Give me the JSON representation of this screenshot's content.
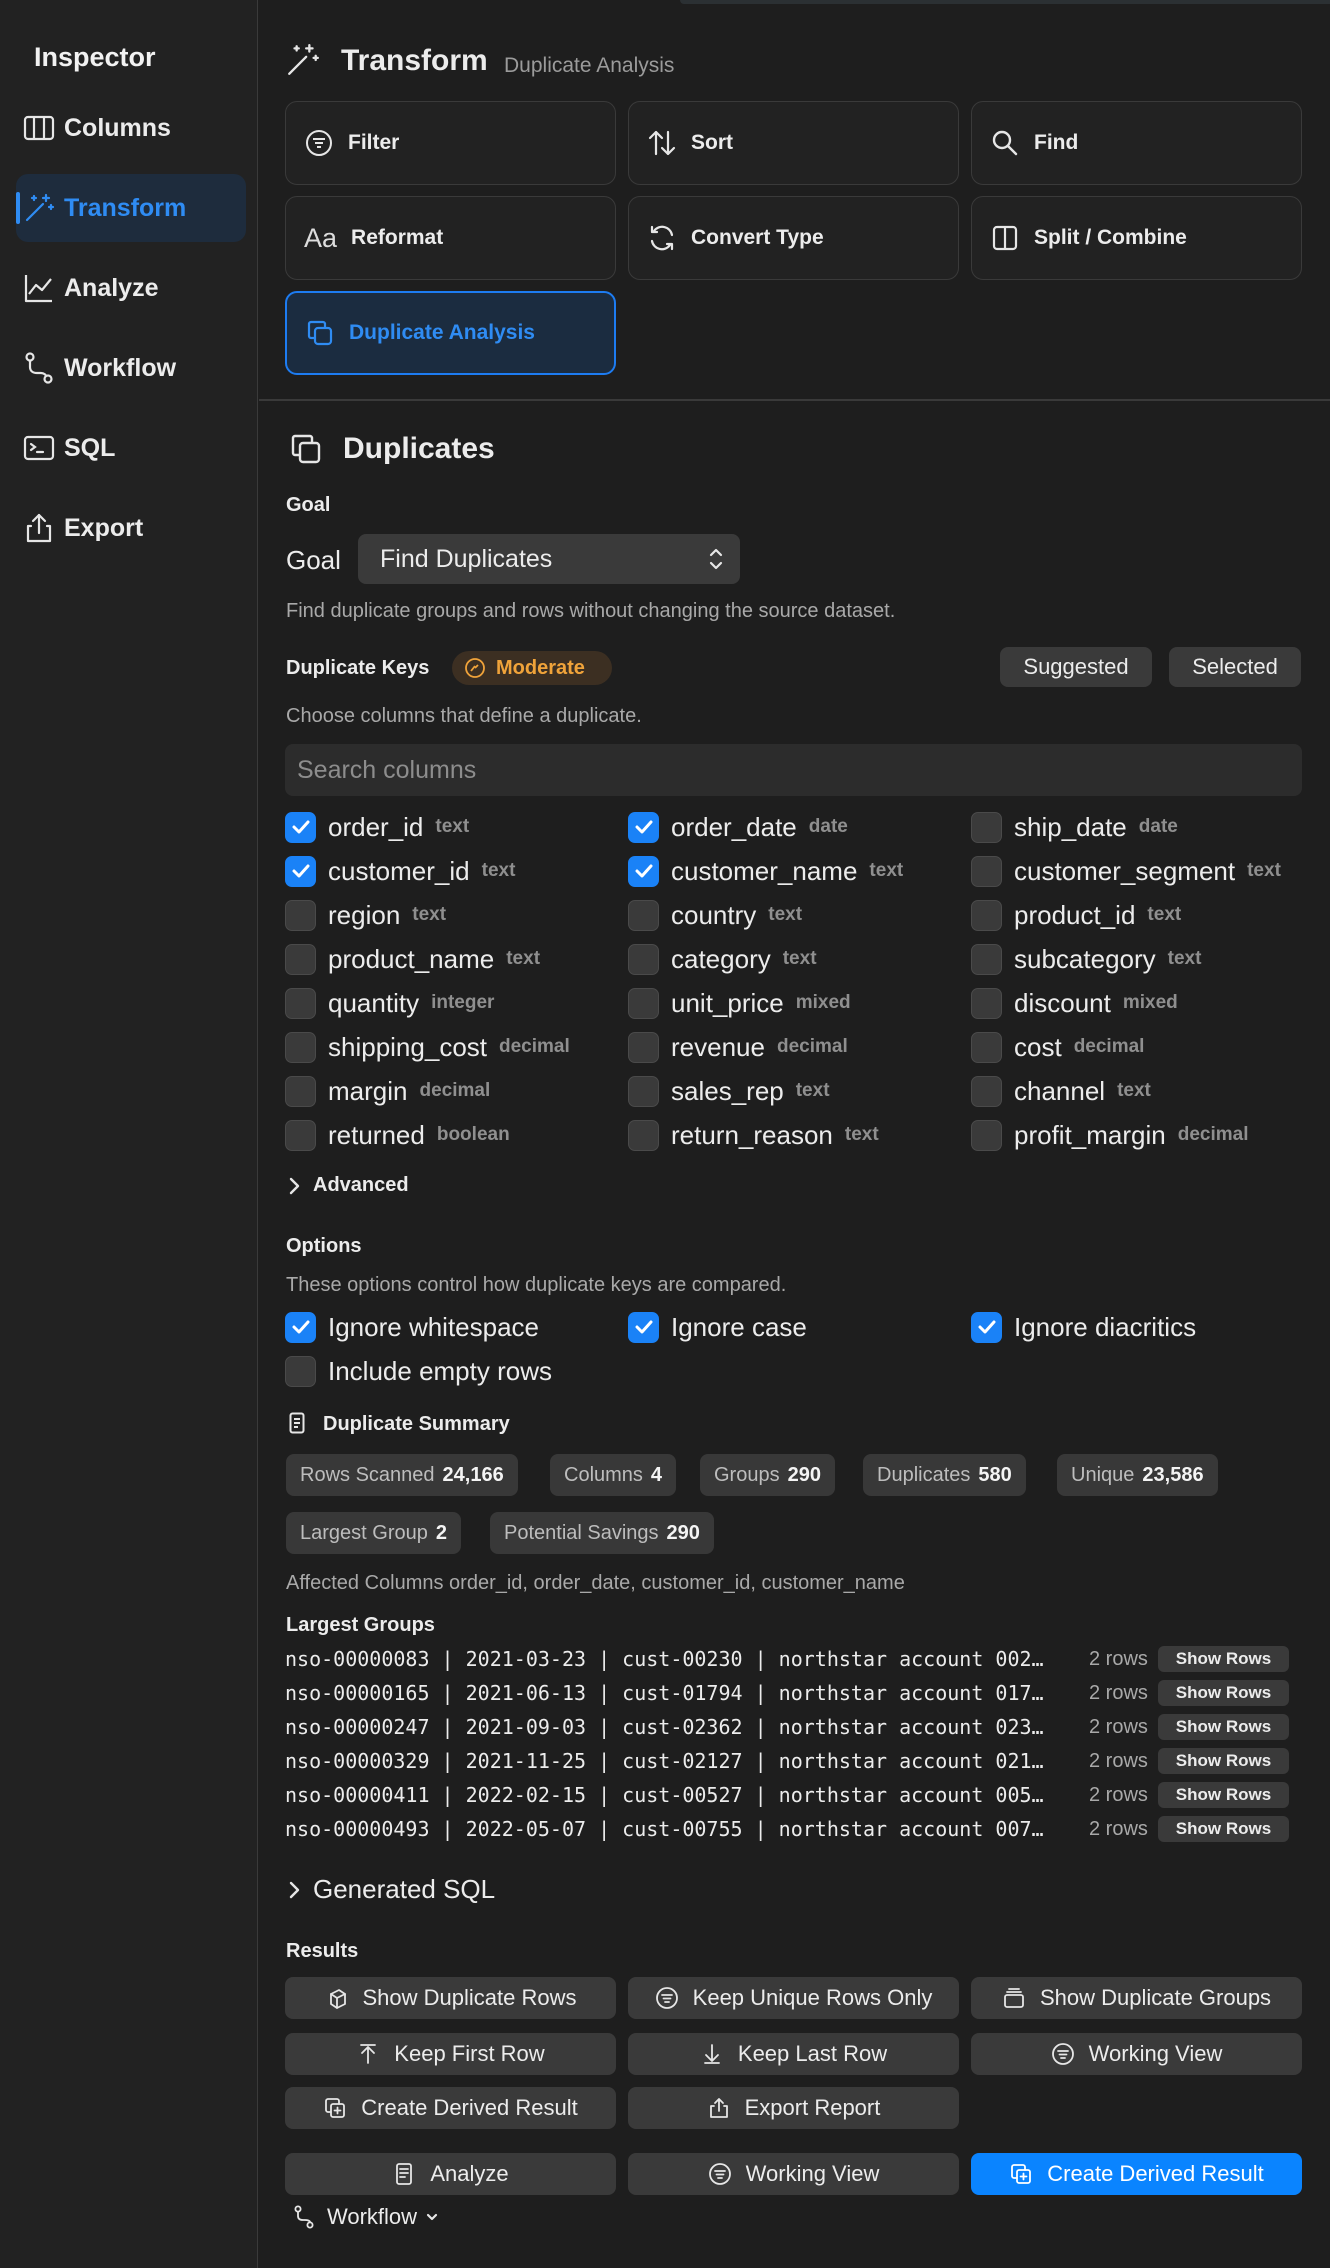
{
  "sidebar": {
    "title": "Inspector",
    "items": [
      {
        "label": "Columns",
        "icon": "columns-icon"
      },
      {
        "label": "Transform",
        "icon": "magic-wand-icon",
        "active": true
      },
      {
        "label": "Analyze",
        "icon": "line-chart-icon"
      },
      {
        "label": "Workflow",
        "icon": "workflow-icon"
      },
      {
        "label": "SQL",
        "icon": "terminal-icon"
      },
      {
        "label": "Export",
        "icon": "share-icon"
      }
    ]
  },
  "header": {
    "title": "Transform",
    "subtitle": "Duplicate Analysis"
  },
  "tools": [
    {
      "label": "Filter",
      "icon": "filter-icon"
    },
    {
      "label": "Sort",
      "icon": "sort-icon"
    },
    {
      "label": "Find",
      "icon": "search-icon"
    },
    {
      "label": "Reformat",
      "icon": "text-format-icon",
      "glyph": "Aa"
    },
    {
      "label": "Convert Type",
      "icon": "convert-icon"
    },
    {
      "label": "Split / Combine",
      "icon": "split-icon"
    },
    {
      "label": "Duplicate Analysis",
      "icon": "duplicate-icon",
      "selected": true
    }
  ],
  "duplicates": {
    "title": "Duplicates",
    "goal_heading": "Goal",
    "goal_label": "Goal",
    "goal_value": "Find Duplicates",
    "goal_help": "Find duplicate groups and rows without changing the source dataset.",
    "keys_label": "Duplicate Keys",
    "strictness": "Moderate",
    "suggested_label": "Suggested",
    "selected_label": "Selected",
    "keys_help": "Choose columns that define a duplicate.",
    "search_placeholder": "Search columns",
    "columns": [
      {
        "name": "order_id",
        "type": "text",
        "checked": true
      },
      {
        "name": "order_date",
        "type": "date",
        "checked": true
      },
      {
        "name": "ship_date",
        "type": "date",
        "checked": false
      },
      {
        "name": "customer_id",
        "type": "text",
        "checked": true
      },
      {
        "name": "customer_name",
        "type": "text",
        "checked": true
      },
      {
        "name": "customer_segment",
        "type": "text",
        "checked": false
      },
      {
        "name": "region",
        "type": "text",
        "checked": false
      },
      {
        "name": "country",
        "type": "text",
        "checked": false
      },
      {
        "name": "product_id",
        "type": "text",
        "checked": false
      },
      {
        "name": "product_name",
        "type": "text",
        "checked": false
      },
      {
        "name": "category",
        "type": "text",
        "checked": false
      },
      {
        "name": "subcategory",
        "type": "text",
        "checked": false
      },
      {
        "name": "quantity",
        "type": "integer",
        "checked": false
      },
      {
        "name": "unit_price",
        "type": "mixed",
        "checked": false
      },
      {
        "name": "discount",
        "type": "mixed",
        "checked": false
      },
      {
        "name": "shipping_cost",
        "type": "decimal",
        "checked": false
      },
      {
        "name": "revenue",
        "type": "decimal",
        "checked": false
      },
      {
        "name": "cost",
        "type": "decimal",
        "checked": false
      },
      {
        "name": "margin",
        "type": "decimal",
        "checked": false
      },
      {
        "name": "sales_rep",
        "type": "text",
        "checked": false
      },
      {
        "name": "channel",
        "type": "text",
        "checked": false
      },
      {
        "name": "returned",
        "type": "boolean",
        "checked": false
      },
      {
        "name": "return_reason",
        "type": "text",
        "checked": false
      },
      {
        "name": "profit_margin",
        "type": "decimal",
        "checked": false
      }
    ],
    "advanced_label": "Advanced",
    "options_label": "Options",
    "options_help": "These options control how duplicate keys are compared.",
    "options": [
      {
        "label": "Ignore whitespace",
        "checked": true
      },
      {
        "label": "Ignore case",
        "checked": true
      },
      {
        "label": "Ignore diacritics",
        "checked": true
      },
      {
        "label": "Include empty rows",
        "checked": false
      }
    ],
    "summary_label": "Duplicate Summary",
    "stats": [
      {
        "k": "Rows Scanned",
        "v": "24,166"
      },
      {
        "k": "Columns",
        "v": "4"
      },
      {
        "k": "Groups",
        "v": "290"
      },
      {
        "k": "Duplicates",
        "v": "580"
      },
      {
        "k": "Unique",
        "v": "23,586"
      },
      {
        "k": "Largest Group",
        "v": "2"
      },
      {
        "k": "Potential Savings",
        "v": "290"
      }
    ],
    "affected": "Affected Columns order_id, order_date, customer_id, customer_name",
    "largest_label": "Largest Groups",
    "groups": [
      {
        "key": "nso-00000083 | 2021-03-23 | cust-00230 | northstar account 002…",
        "rows": "2 rows"
      },
      {
        "key": "nso-00000165 | 2021-06-13 | cust-01794 | northstar account 017…",
        "rows": "2 rows"
      },
      {
        "key": "nso-00000247 | 2021-09-03 | cust-02362 | northstar account 023…",
        "rows": "2 rows"
      },
      {
        "key": "nso-00000329 | 2021-11-25 | cust-02127 | northstar account 021…",
        "rows": "2 rows"
      },
      {
        "key": "nso-00000411 | 2022-02-15 | cust-00527 | northstar account 005…",
        "rows": "2 rows"
      },
      {
        "key": "nso-00000493 | 2022-05-07 | cust-00755 | northstar account 007…",
        "rows": "2 rows"
      }
    ],
    "show_rows_label": "Show Rows",
    "generated_sql_label": "Generated SQL",
    "results_label": "Results",
    "results": [
      {
        "label": "Show Duplicate Rows",
        "icon": "stack-icon"
      },
      {
        "label": "Keep Unique Rows Only",
        "icon": "filter-icon"
      },
      {
        "label": "Show Duplicate Groups",
        "icon": "group-icon"
      },
      {
        "label": "Keep First Row",
        "icon": "arrow-up-icon"
      },
      {
        "label": "Keep Last Row",
        "icon": "arrow-down-icon"
      },
      {
        "label": "Working View",
        "icon": "filter-icon"
      },
      {
        "label": "Create Derived Result",
        "icon": "copy-plus-icon"
      },
      {
        "label": "Export Report",
        "icon": "share-icon"
      }
    ],
    "footer": [
      {
        "label": "Analyze",
        "icon": "document-icon"
      },
      {
        "label": "Working View",
        "icon": "filter-icon"
      },
      {
        "label": "Create Derived Result",
        "icon": "copy-plus-icon",
        "primary": true
      }
    ],
    "workflow_label": "Workflow"
  },
  "colors": {
    "accent": "#0a84ff",
    "warning": "#f0a33a",
    "background": "#1e1e1e"
  }
}
